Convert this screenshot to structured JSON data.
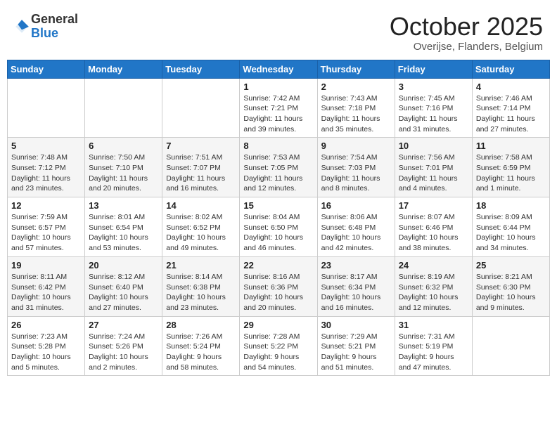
{
  "header": {
    "logo_general": "General",
    "logo_blue": "Blue",
    "month_title": "October 2025",
    "subtitle": "Overijse, Flanders, Belgium"
  },
  "weekdays": [
    "Sunday",
    "Monday",
    "Tuesday",
    "Wednesday",
    "Thursday",
    "Friday",
    "Saturday"
  ],
  "weeks": [
    [
      {
        "day": "",
        "info": ""
      },
      {
        "day": "",
        "info": ""
      },
      {
        "day": "",
        "info": ""
      },
      {
        "day": "1",
        "info": "Sunrise: 7:42 AM\nSunset: 7:21 PM\nDaylight: 11 hours and 39 minutes."
      },
      {
        "day": "2",
        "info": "Sunrise: 7:43 AM\nSunset: 7:18 PM\nDaylight: 11 hours and 35 minutes."
      },
      {
        "day": "3",
        "info": "Sunrise: 7:45 AM\nSunset: 7:16 PM\nDaylight: 11 hours and 31 minutes."
      },
      {
        "day": "4",
        "info": "Sunrise: 7:46 AM\nSunset: 7:14 PM\nDaylight: 11 hours and 27 minutes."
      }
    ],
    [
      {
        "day": "5",
        "info": "Sunrise: 7:48 AM\nSunset: 7:12 PM\nDaylight: 11 hours and 23 minutes."
      },
      {
        "day": "6",
        "info": "Sunrise: 7:50 AM\nSunset: 7:10 PM\nDaylight: 11 hours and 20 minutes."
      },
      {
        "day": "7",
        "info": "Sunrise: 7:51 AM\nSunset: 7:07 PM\nDaylight: 11 hours and 16 minutes."
      },
      {
        "day": "8",
        "info": "Sunrise: 7:53 AM\nSunset: 7:05 PM\nDaylight: 11 hours and 12 minutes."
      },
      {
        "day": "9",
        "info": "Sunrise: 7:54 AM\nSunset: 7:03 PM\nDaylight: 11 hours and 8 minutes."
      },
      {
        "day": "10",
        "info": "Sunrise: 7:56 AM\nSunset: 7:01 PM\nDaylight: 11 hours and 4 minutes."
      },
      {
        "day": "11",
        "info": "Sunrise: 7:58 AM\nSunset: 6:59 PM\nDaylight: 11 hours and 1 minute."
      }
    ],
    [
      {
        "day": "12",
        "info": "Sunrise: 7:59 AM\nSunset: 6:57 PM\nDaylight: 10 hours and 57 minutes."
      },
      {
        "day": "13",
        "info": "Sunrise: 8:01 AM\nSunset: 6:54 PM\nDaylight: 10 hours and 53 minutes."
      },
      {
        "day": "14",
        "info": "Sunrise: 8:02 AM\nSunset: 6:52 PM\nDaylight: 10 hours and 49 minutes."
      },
      {
        "day": "15",
        "info": "Sunrise: 8:04 AM\nSunset: 6:50 PM\nDaylight: 10 hours and 46 minutes."
      },
      {
        "day": "16",
        "info": "Sunrise: 8:06 AM\nSunset: 6:48 PM\nDaylight: 10 hours and 42 minutes."
      },
      {
        "day": "17",
        "info": "Sunrise: 8:07 AM\nSunset: 6:46 PM\nDaylight: 10 hours and 38 minutes."
      },
      {
        "day": "18",
        "info": "Sunrise: 8:09 AM\nSunset: 6:44 PM\nDaylight: 10 hours and 34 minutes."
      }
    ],
    [
      {
        "day": "19",
        "info": "Sunrise: 8:11 AM\nSunset: 6:42 PM\nDaylight: 10 hours and 31 minutes."
      },
      {
        "day": "20",
        "info": "Sunrise: 8:12 AM\nSunset: 6:40 PM\nDaylight: 10 hours and 27 minutes."
      },
      {
        "day": "21",
        "info": "Sunrise: 8:14 AM\nSunset: 6:38 PM\nDaylight: 10 hours and 23 minutes."
      },
      {
        "day": "22",
        "info": "Sunrise: 8:16 AM\nSunset: 6:36 PM\nDaylight: 10 hours and 20 minutes."
      },
      {
        "day": "23",
        "info": "Sunrise: 8:17 AM\nSunset: 6:34 PM\nDaylight: 10 hours and 16 minutes."
      },
      {
        "day": "24",
        "info": "Sunrise: 8:19 AM\nSunset: 6:32 PM\nDaylight: 10 hours and 12 minutes."
      },
      {
        "day": "25",
        "info": "Sunrise: 8:21 AM\nSunset: 6:30 PM\nDaylight: 10 hours and 9 minutes."
      }
    ],
    [
      {
        "day": "26",
        "info": "Sunrise: 7:23 AM\nSunset: 5:28 PM\nDaylight: 10 hours and 5 minutes."
      },
      {
        "day": "27",
        "info": "Sunrise: 7:24 AM\nSunset: 5:26 PM\nDaylight: 10 hours and 2 minutes."
      },
      {
        "day": "28",
        "info": "Sunrise: 7:26 AM\nSunset: 5:24 PM\nDaylight: 9 hours and 58 minutes."
      },
      {
        "day": "29",
        "info": "Sunrise: 7:28 AM\nSunset: 5:22 PM\nDaylight: 9 hours and 54 minutes."
      },
      {
        "day": "30",
        "info": "Sunrise: 7:29 AM\nSunset: 5:21 PM\nDaylight: 9 hours and 51 minutes."
      },
      {
        "day": "31",
        "info": "Sunrise: 7:31 AM\nSunset: 5:19 PM\nDaylight: 9 hours and 47 minutes."
      },
      {
        "day": "",
        "info": ""
      }
    ]
  ]
}
